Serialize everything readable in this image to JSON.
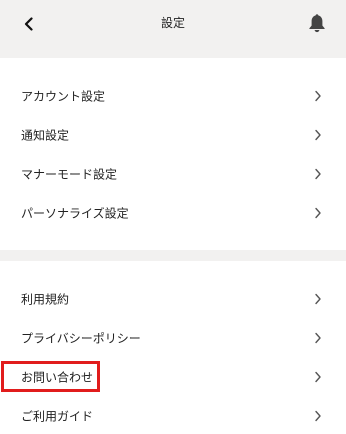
{
  "header": {
    "title": "設定",
    "back_icon": "chevron-left-icon",
    "bell_icon": "bell-icon"
  },
  "sections": [
    {
      "items": [
        {
          "label": "アカウント設定"
        },
        {
          "label": "通知設定"
        },
        {
          "label": "マナーモード設定"
        },
        {
          "label": "パーソナライズ設定"
        }
      ]
    },
    {
      "items": [
        {
          "label": "利用規約"
        },
        {
          "label": "プライバシーポリシー"
        },
        {
          "label": "お問い合わせ",
          "highlighted": true
        },
        {
          "label": "ご利用ガイド"
        }
      ]
    }
  ],
  "colors": {
    "background": "#f2f1f0",
    "card": "#ffffff",
    "highlight": "#e11c1c"
  }
}
